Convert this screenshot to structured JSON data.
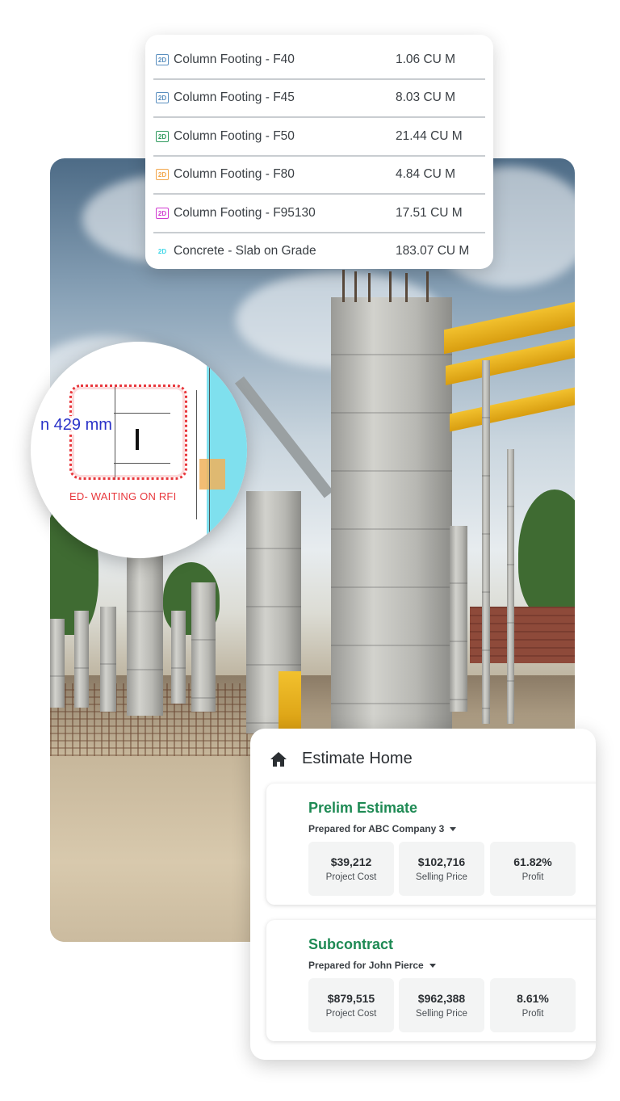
{
  "quantities": [
    {
      "name": "Column Footing - F40",
      "value": "1.06 CU M",
      "badge": "2D",
      "color": "#5a8fbf"
    },
    {
      "name": "Column Footing - F45",
      "value": "8.03 CU M",
      "badge": "2D",
      "color": "#5a8fbf"
    },
    {
      "name": "Column Footing - F50",
      "value": "21.44 CU M",
      "badge": "2D",
      "color": "#2f9a5e"
    },
    {
      "name": "Column Footing - F80",
      "value": "4.84 CU M",
      "badge": "2D",
      "color": "#f2a64a"
    },
    {
      "name": "Column Footing - F95130",
      "value": "17.51 CU M",
      "badge": "2D",
      "color": "#d13bd1"
    },
    {
      "name": "Concrete - Slab on Grade",
      "value": "183.07 CU M",
      "badge": "2D",
      "color": "#3fd7e8"
    }
  ],
  "markup": {
    "dimension": "n 429 mm",
    "note": "ED- WAITING ON RFI"
  },
  "estimate_home": {
    "title": "Estimate Home",
    "estimates": [
      {
        "name": "Prelim Estimate",
        "prepared_for": "Prepared for ABC Company 3",
        "stats": [
          {
            "value": "$39,212",
            "label": "Project Cost"
          },
          {
            "value": "$102,716",
            "label": "Selling Price"
          },
          {
            "value": "61.82%",
            "label": "Profit"
          }
        ]
      },
      {
        "name": "Subcontract",
        "prepared_for": "Prepared for John Pierce",
        "stats": [
          {
            "value": "$879,515",
            "label": "Project Cost"
          },
          {
            "value": "$962,388",
            "label": "Selling Price"
          },
          {
            "value": "8.61%",
            "label": "Profit"
          }
        ]
      }
    ]
  },
  "colors": {
    "accent_green": "#1e8a54",
    "markup_red": "#e8383d",
    "dimension_blue": "#2a32c8"
  }
}
